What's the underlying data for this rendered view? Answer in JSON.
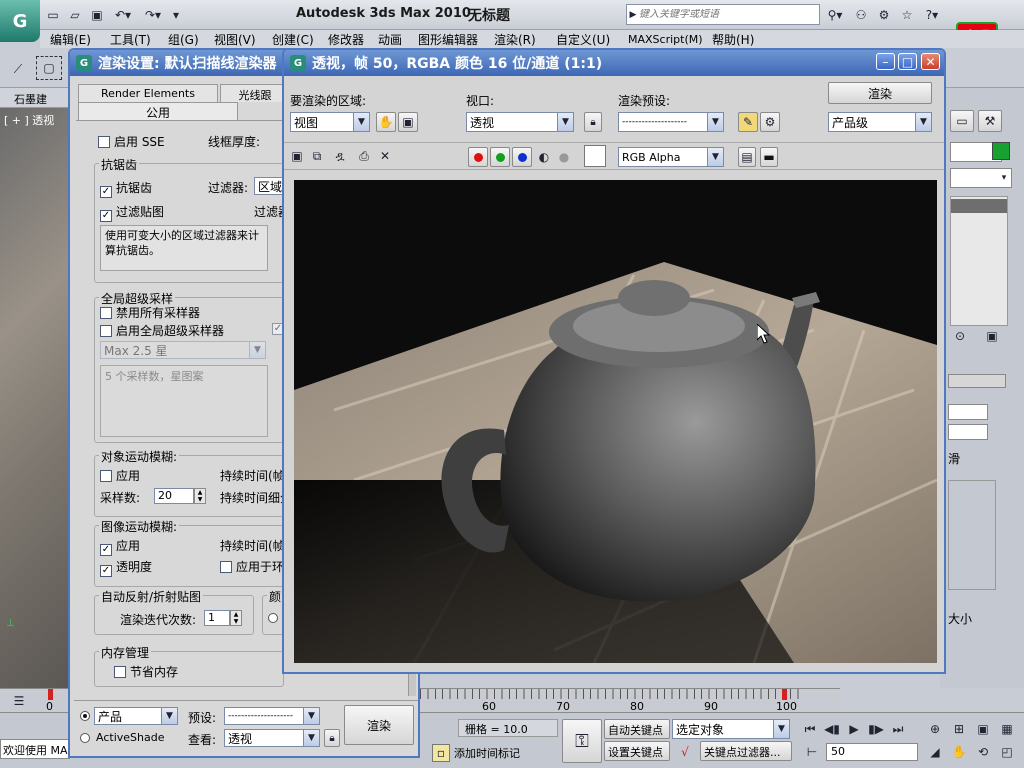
{
  "app": {
    "title": "Autodesk 3ds Max 2010",
    "doc_title": "无标题",
    "search_placeholder": "键入关键字或短语"
  },
  "menu": [
    "编辑(E)",
    "工具(T)",
    "组(G)",
    "视图(V)",
    "创建(C)",
    "修改器",
    "动画",
    "图形编辑器",
    "渲染(R)",
    "自定义(U)",
    "MAXScript(M)",
    "帮助(H)"
  ],
  "viewport": {
    "label": "[ + ] 透视",
    "tab_left": "石墨建"
  },
  "render_setup": {
    "title": "渲染设置: 默认扫描线渲染器",
    "tabs": {
      "render_elements": "Render Elements",
      "raytracer": "光线跟",
      "common": "公用"
    },
    "sse_label": "启用 SSE",
    "wire_label": "线框厚度:",
    "antialias": {
      "group": "抗锯齿",
      "aa_label": "抗锯齿",
      "filter_label": "过滤器:",
      "filter_value": "区域",
      "filter_maps": "过滤贴图",
      "filter_size": "过滤器",
      "desc": "使用可变大小的区域过滤器来计算抗锯齿。"
    },
    "supersample": {
      "group": "全局超级采样",
      "disable_all": "禁用所有采样器",
      "enable_global": "启用全局超级采样器",
      "sampler_value": "Max 2.5 星",
      "desc": "5 个采样数，星图案"
    },
    "object_blur": {
      "group": "对象运动模糊:",
      "apply": "应用",
      "duration": "持续时间(帧",
      "samples_label": "采样数:",
      "samples_value": "20",
      "duration_sub": "持续时间细分"
    },
    "image_blur": {
      "group": "图像运动模糊:",
      "apply": "应用",
      "duration": "持续时间(帧",
      "transparency": "透明度",
      "apply_env": "应用于环"
    },
    "reflect": {
      "group": "自动反射/折射贴图",
      "iter_label": "渲染迭代次数:",
      "iter_value": "1",
      "color_group": "颜"
    },
    "memory": {
      "group": "内存管理",
      "save_mem": "节省内存"
    },
    "bottom": {
      "production": "产品",
      "activeshade": "ActiveShade",
      "preset_label": "预设:",
      "preset_value": "--------------------",
      "view_label": "查看:",
      "view_value": "透视",
      "render_btn": "渲染"
    }
  },
  "frame_window": {
    "title": "透视，帧 50，RGBA 颜色 16 位/通道 (1:1)",
    "area_label": "要渲染的区域:",
    "area_value": "视图",
    "viewport_label": "视口:",
    "viewport_value": "透视",
    "preset_label": "渲染预设:",
    "preset_value": "--------------------",
    "render_btn": "渲染",
    "mode_value": "产品级",
    "channel_value": "RGB Alpha"
  },
  "right_panel": {
    "spinner_text": "滑",
    "side_text": "大小"
  },
  "timeline": {
    "ticks": [
      "60",
      "70",
      "80",
      "90",
      "100"
    ]
  },
  "status": {
    "welcome": "欢迎使用 MA",
    "grid": "栅格 = 10.0",
    "add_time_tag": "添加时间标记",
    "auto_key": "自动关键点",
    "set_key": "设置关键点",
    "selected": "选定对象",
    "key_filter": "关键点过滤器...",
    "frame": "50",
    "frame_counter": "0 / 100"
  },
  "logo": {
    "line1": "育碟",
    "line2": "软件"
  },
  "colors": {
    "accent_blue": "#3d67b5",
    "render_bg": "#0c0c0c"
  }
}
